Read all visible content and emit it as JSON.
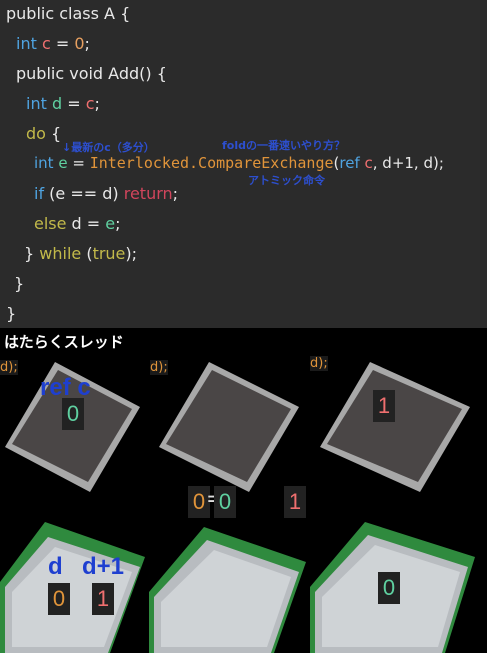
{
  "code": {
    "l1": "public class A {",
    "l2_kw": "int",
    "l2_var": "c",
    "l2_eq": " = ",
    "l2_num": "0",
    "l2_end": ";",
    "l3": "public void Add() {",
    "l4_kw": "int",
    "l4_var": "d",
    "l4_eq": " = ",
    "l4_rhs": "c",
    "l4_end": ";",
    "l5_kw": "do",
    "l5_end": " {",
    "l6_kw": "int",
    "l6_var": "e",
    "l6_eq": " = ",
    "l6_fn": "Interlocked.CompareExchange",
    "l6_open": "(",
    "l6_ref": "ref",
    "l6_c": " c",
    "l6_args": ", d+1, d);",
    "l7_kw": "if",
    "l7_mid": " (e == d) ",
    "l7_ret": "return",
    "l7_end": ";",
    "l8_kw": "else",
    "l8_mid": " d = ",
    "l8_e": "e",
    "l8_end": ";",
    "l9_close": "} ",
    "l9_kw": "while",
    "l9_open": " (",
    "l9_true": "true",
    "l9_end": ");",
    "l10": "}",
    "l11": "}"
  },
  "notes": {
    "latest": "↓最新のc（多分）",
    "fold": "foldの一番速いやり方？",
    "atomic": "アトミック命令"
  },
  "panel": {
    "title": "はたらくスレッド",
    "peek": "d);",
    "ref_label": "ref c",
    "d_label": "d",
    "d1_label": "d+1",
    "p1_ref_val": "0",
    "p1_d_val": "0",
    "p1_d1_val": "1",
    "p2_left": "0",
    "p2_eq": "=",
    "p2_right": "0",
    "p2_out": "1",
    "p3_ref_val": "1",
    "p3_d_val": "0"
  },
  "colors": {
    "orange": "#e0943a",
    "green": "#5fd0a0",
    "red": "#ef6f6f",
    "blue": "#1e3fd0"
  }
}
